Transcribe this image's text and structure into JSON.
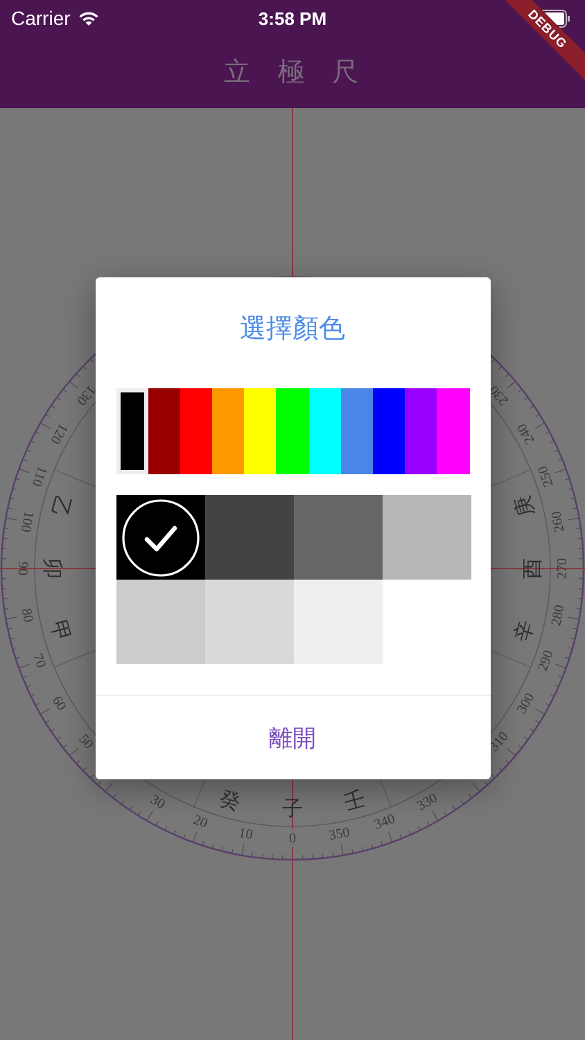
{
  "status_bar": {
    "carrier": "Carrier",
    "time": "3:58 PM"
  },
  "debug_banner": "DEBUG",
  "app_bar": {
    "title": "立 極 尺"
  },
  "dial": {
    "degree_labels": [
      "130",
      "120",
      "110",
      "100",
      "90",
      "80",
      "70",
      "60",
      "50",
      "30",
      "20",
      "10",
      "0",
      "350",
      "340",
      "330",
      "310",
      "300",
      "290",
      "280",
      "270",
      "260",
      "250",
      "240",
      "230"
    ],
    "direction_labels": [
      "乙",
      "卯",
      "甲",
      "癸",
      "子",
      "壬",
      "庚",
      "酉",
      "辛"
    ]
  },
  "dialog": {
    "title": "選擇顏色",
    "palette": [
      {
        "color": "#000000",
        "selected": true
      },
      {
        "color": "#990000",
        "selected": false
      },
      {
        "color": "#ff0000",
        "selected": false
      },
      {
        "color": "#ff9900",
        "selected": false
      },
      {
        "color": "#ffff00",
        "selected": false
      },
      {
        "color": "#00ff00",
        "selected": false
      },
      {
        "color": "#00ffff",
        "selected": false
      },
      {
        "color": "#4a86e8",
        "selected": false
      },
      {
        "color": "#0000ff",
        "selected": false
      },
      {
        "color": "#9900ff",
        "selected": false
      },
      {
        "color": "#ff00ff",
        "selected": false
      }
    ],
    "shades": [
      {
        "color": "#000000",
        "selected": true
      },
      {
        "color": "#434343",
        "selected": false
      },
      {
        "color": "#666666",
        "selected": false
      },
      {
        "color": "#b7b7b7",
        "selected": false
      },
      {
        "color": "#cccccc",
        "selected": false
      },
      {
        "color": "#d9d9d9",
        "selected": false
      },
      {
        "color": "#efefef",
        "selected": false
      }
    ],
    "close_button": "離開"
  }
}
